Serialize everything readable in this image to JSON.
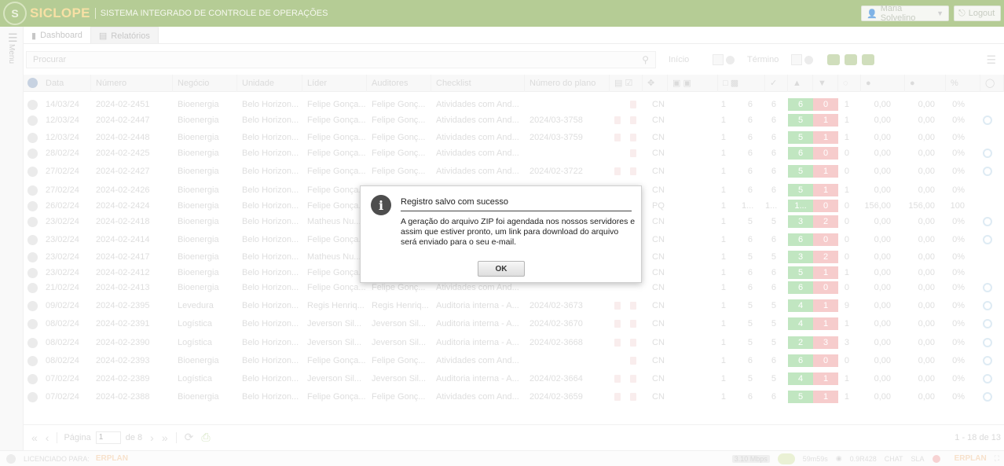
{
  "header": {
    "logo_letter": "S",
    "brand": "SICLOPE",
    "subtitle": "SISTEMA INTEGRADO DE CONTROLE DE OPERAÇÕES",
    "user": "Maria Solvelino",
    "logout": "Logout"
  },
  "rail": {
    "label": "Menu"
  },
  "tabs": [
    {
      "label": "Dashboard"
    },
    {
      "label": "Relatórios"
    }
  ],
  "toolbar": {
    "search_placeholder": "Procurar",
    "start_label": "Início",
    "end_label": "Término"
  },
  "table": {
    "columns": [
      "Data",
      "Número",
      "Negócio",
      "Unidade",
      "Líder",
      "Auditores",
      "Checklist",
      "Número do plano"
    ],
    "rows": [
      {
        "data": "14/03/24",
        "numero": "2024-02-2451",
        "negocio": "Bioenergia",
        "unidade": "Belo Horizon...",
        "lider": "Felipe Gonça...",
        "auditores": "Felipe Gonç...",
        "checklist": "Atividades com And...",
        "plano": "",
        "tipo": "CN",
        "c1": "1",
        "c2": "6",
        "c3": "6",
        "pos": "6",
        "neg": "0",
        "c4": "1",
        "v1": "0,00",
        "v2": "0,00",
        "pct": "0%",
        "docs": 1,
        "circ": false
      },
      {
        "data": "12/03/24",
        "numero": "2024-02-2447",
        "negocio": "Bioenergia",
        "unidade": "Belo Horizon...",
        "lider": "Felipe Gonça...",
        "auditores": "Felipe Gonç...",
        "checklist": "Atividades com And...",
        "plano": "2024/03-3758",
        "tipo": "CN",
        "c1": "1",
        "c2": "6",
        "c3": "6",
        "pos": "5",
        "neg": "1",
        "c4": "1",
        "v1": "0,00",
        "v2": "0,00",
        "pct": "0%",
        "docs": 2,
        "circ": true
      },
      {
        "data": "12/03/24",
        "numero": "2024-02-2448",
        "negocio": "Bioenergia",
        "unidade": "Belo Horizon...",
        "lider": "Felipe Gonça...",
        "auditores": "Felipe Gonç...",
        "checklist": "Atividades com And...",
        "plano": "2024/03-3759",
        "tipo": "CN",
        "c1": "1",
        "c2": "6",
        "c3": "6",
        "pos": "5",
        "neg": "1",
        "c4": "1",
        "v1": "0,00",
        "v2": "0,00",
        "pct": "0%",
        "docs": 2,
        "circ": false
      },
      {
        "data": "28/02/24",
        "numero": "2024-02-2425",
        "negocio": "Bioenergia",
        "unidade": "Belo Horizon...",
        "lider": "Felipe Gonça...",
        "auditores": "Felipe Gonç...",
        "checklist": "Atividades com And...",
        "plano": "",
        "tipo": "CN",
        "c1": "1",
        "c2": "6",
        "c3": "6",
        "pos": "6",
        "neg": "0",
        "c4": "0",
        "v1": "0,00",
        "v2": "0,00",
        "pct": "0%",
        "docs": 1,
        "circ": true
      },
      {
        "data": "27/02/24",
        "numero": "2024-02-2427",
        "negocio": "Bioenergia",
        "unidade": "Belo Horizon...",
        "lider": "Felipe Gonça...",
        "auditores": "Felipe Gonç...",
        "checklist": "Atividades com And...",
        "plano": "2024/02-3722",
        "tipo": "CN",
        "c1": "1",
        "c2": "6",
        "c3": "6",
        "pos": "5",
        "neg": "1",
        "c4": "0",
        "v1": "0,00",
        "v2": "0,00",
        "pct": "0%",
        "docs": 2,
        "circ": true
      },
      {
        "data": "27/02/24",
        "numero": "2024-02-2426",
        "negocio": "Bioenergia",
        "unidade": "Belo Horizon...",
        "lider": "Felipe Gonça...",
        "auditores": "",
        "checklist": "",
        "plano": "",
        "tipo": "CN",
        "c1": "1",
        "c2": "6",
        "c3": "6",
        "pos": "5",
        "neg": "1",
        "c4": "1",
        "v1": "0,00",
        "v2": "0,00",
        "pct": "0%",
        "docs": 0,
        "circ": false
      },
      {
        "data": "26/02/24",
        "numero": "2024-02-2424",
        "negocio": "Bioenergia",
        "unidade": "Belo Horizon...",
        "lider": "Felipe Gonça...",
        "auditores": "",
        "checklist": "",
        "plano": "",
        "tipo": "PQ",
        "c1": "1",
        "c2": "1...",
        "c3": "1...",
        "pos": "1...",
        "neg": "0",
        "c4": "0",
        "v1": "156,00",
        "v2": "156,00",
        "pct": "100",
        "docs": 0,
        "circ": false
      },
      {
        "data": "23/02/24",
        "numero": "2024-02-2418",
        "negocio": "Bioenergia",
        "unidade": "Belo Horizon...",
        "lider": "Matheus Nu...",
        "auditores": "",
        "checklist": "",
        "plano": "",
        "tipo": "CN",
        "c1": "1",
        "c2": "5",
        "c3": "5",
        "pos": "3",
        "neg": "2",
        "c4": "0",
        "v1": "0,00",
        "v2": "0,00",
        "pct": "0%",
        "docs": 0,
        "circ": true
      },
      {
        "data": "23/02/24",
        "numero": "2024-02-2414",
        "negocio": "Bioenergia",
        "unidade": "Belo Horizon...",
        "lider": "Felipe Gonça...",
        "auditores": "",
        "checklist": "",
        "plano": "",
        "tipo": "CN",
        "c1": "1",
        "c2": "6",
        "c3": "6",
        "pos": "6",
        "neg": "0",
        "c4": "0",
        "v1": "0,00",
        "v2": "0,00",
        "pct": "0%",
        "docs": 0,
        "circ": true
      },
      {
        "data": "23/02/24",
        "numero": "2024-02-2417",
        "negocio": "Bioenergia",
        "unidade": "Belo Horizon...",
        "lider": "Matheus Nu...",
        "auditores": "",
        "checklist": "",
        "plano": "",
        "tipo": "CN",
        "c1": "1",
        "c2": "5",
        "c3": "5",
        "pos": "3",
        "neg": "2",
        "c4": "0",
        "v1": "0,00",
        "v2": "0,00",
        "pct": "0%",
        "docs": 0,
        "circ": false
      },
      {
        "data": "23/02/24",
        "numero": "2024-02-2412",
        "negocio": "Bioenergia",
        "unidade": "Belo Horizon...",
        "lider": "Felipe Gonça...",
        "auditores": "",
        "checklist": "",
        "plano": "",
        "tipo": "CN",
        "c1": "1",
        "c2": "6",
        "c3": "6",
        "pos": "5",
        "neg": "1",
        "c4": "1",
        "v1": "0,00",
        "v2": "0,00",
        "pct": "0%",
        "docs": 0,
        "circ": false
      },
      {
        "data": "21/02/24",
        "numero": "2024-02-2413",
        "negocio": "Bioenergia",
        "unidade": "Belo Horizon...",
        "lider": "Felipe Gonça...",
        "auditores": "Felipe Gonç...",
        "checklist": "Atividades com And...",
        "plano": "",
        "tipo": "CN",
        "c1": "1",
        "c2": "6",
        "c3": "6",
        "pos": "6",
        "neg": "0",
        "c4": "0",
        "v1": "0,00",
        "v2": "0,00",
        "pct": "0%",
        "docs": 0,
        "circ": true
      },
      {
        "data": "09/02/24",
        "numero": "2024-02-2395",
        "negocio": "Levedura",
        "unidade": "Belo Horizon...",
        "lider": "Regis Henriq...",
        "auditores": "Regis Henriq...",
        "checklist": "Auditoria interna - A...",
        "plano": "2024/02-3673",
        "tipo": "CN",
        "c1": "1",
        "c2": "5",
        "c3": "5",
        "pos": "4",
        "neg": "1",
        "c4": "9",
        "v1": "0,00",
        "v2": "0,00",
        "pct": "0%",
        "docs": 2,
        "circ": true
      },
      {
        "data": "08/02/24",
        "numero": "2024-02-2391",
        "negocio": "Logística",
        "unidade": "Belo Horizon...",
        "lider": "Jeverson Sil...",
        "auditores": "Jeverson Sil...",
        "checklist": "Auditoria interna - A...",
        "plano": "2024/02-3670",
        "tipo": "CN",
        "c1": "1",
        "c2": "5",
        "c3": "5",
        "pos": "4",
        "neg": "1",
        "c4": "1",
        "v1": "0,00",
        "v2": "0,00",
        "pct": "0%",
        "docs": 2,
        "circ": true
      },
      {
        "data": "08/02/24",
        "numero": "2024-02-2390",
        "negocio": "Logística",
        "unidade": "Belo Horizon...",
        "lider": "Jeverson Sil...",
        "auditores": "Jeverson Sil...",
        "checklist": "Auditoria interna - A...",
        "plano": "2024/02-3668",
        "tipo": "CN",
        "c1": "1",
        "c2": "5",
        "c3": "5",
        "pos": "2",
        "neg": "3",
        "c4": "3",
        "v1": "0,00",
        "v2": "0,00",
        "pct": "0%",
        "docs": 2,
        "circ": true
      },
      {
        "data": "08/02/24",
        "numero": "2024-02-2393",
        "negocio": "Bioenergia",
        "unidade": "Belo Horizon...",
        "lider": "Felipe Gonça...",
        "auditores": "Felipe Gonç...",
        "checklist": "Atividades com And...",
        "plano": "",
        "tipo": "CN",
        "c1": "1",
        "c2": "6",
        "c3": "6",
        "pos": "6",
        "neg": "0",
        "c4": "0",
        "v1": "0,00",
        "v2": "0,00",
        "pct": "0%",
        "docs": 1,
        "circ": true
      },
      {
        "data": "07/02/24",
        "numero": "2024-02-2389",
        "negocio": "Logística",
        "unidade": "Belo Horizon...",
        "lider": "Jeverson Sil...",
        "auditores": "Jeverson Sil...",
        "checklist": "Auditoria interna - A...",
        "plano": "2024/02-3664",
        "tipo": "CN",
        "c1": "1",
        "c2": "5",
        "c3": "5",
        "pos": "4",
        "neg": "1",
        "c4": "1",
        "v1": "0,00",
        "v2": "0,00",
        "pct": "0%",
        "docs": 2,
        "circ": true
      },
      {
        "data": "07/02/24",
        "numero": "2024-02-2388",
        "negocio": "Bioenergia",
        "unidade": "Belo Horizon...",
        "lider": "Felipe Gonça...",
        "auditores": "Felipe Gonç...",
        "checklist": "Atividades com And...",
        "plano": "2024/02-3659",
        "tipo": "CN",
        "c1": "1",
        "c2": "6",
        "c3": "6",
        "pos": "5",
        "neg": "1",
        "c4": "1",
        "v1": "0,00",
        "v2": "0,00",
        "pct": "0%",
        "docs": 2,
        "circ": true
      }
    ]
  },
  "pager": {
    "page_label": "Página",
    "page_value": "1",
    "of_label": "de 8",
    "range": "1 - 18 de 13"
  },
  "footer": {
    "licensed_label": "LICENCIADO PARA:",
    "brand": "ERPLAN",
    "speed": "3.10 Mbps",
    "time": "59m59s",
    "session": "0.9R428",
    "chat": "CHAT",
    "sla": "SLA",
    "brand2": "ERPLAN"
  },
  "dialog": {
    "icon_letter": "i",
    "title": "Registro salvo com sucesso",
    "message": "A geração do arquivo ZIP foi agendada nos nossos servidores e assim que estiver pronto, um link para download do arquivo será enviado para o seu e-mail.",
    "ok_label": "OK"
  },
  "colors": {
    "header_green": "#79a33f",
    "brand_yellow": "#f1c75c",
    "positive": "#8fd28f",
    "negative": "#eea3a3"
  }
}
